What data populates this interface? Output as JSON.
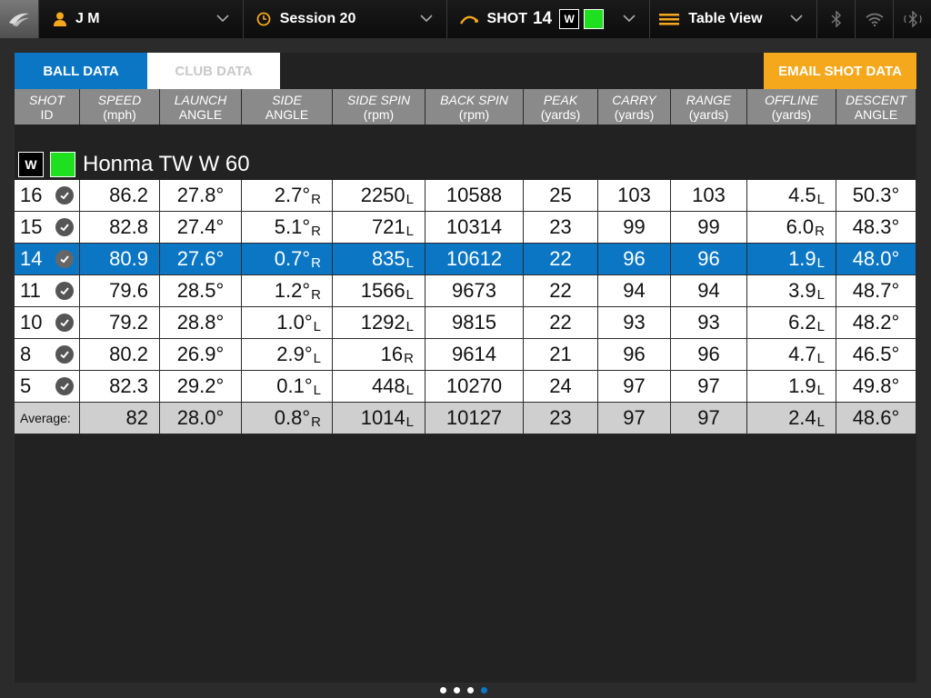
{
  "topbar": {
    "user": "J M",
    "session": "Session 20",
    "shot_label": "SHOT",
    "shot_number": "14",
    "club_badge": "W",
    "view": "Table View"
  },
  "tabs": {
    "ball": "BALL DATA",
    "club": "CLUB DATA",
    "email": "EMAIL SHOT DATA"
  },
  "headers": [
    {
      "t": "SHOT",
      "b": "ID"
    },
    {
      "t": "SPEED",
      "b": "(mph)"
    },
    {
      "t": "LAUNCH",
      "b": "ANGLE"
    },
    {
      "t": "SIDE",
      "b": "ANGLE"
    },
    {
      "t": "SIDE SPIN",
      "b": "(rpm)"
    },
    {
      "t": "BACK SPIN",
      "b": "(rpm)"
    },
    {
      "t": "PEAK",
      "b": "(yards)"
    },
    {
      "t": "CARRY",
      "b": "(yards)"
    },
    {
      "t": "RANGE",
      "b": "(yards)"
    },
    {
      "t": "OFFLINE",
      "b": "(yards)"
    },
    {
      "t": "DESCENT",
      "b": "ANGLE"
    }
  ],
  "club": {
    "badge": "W",
    "name": "Honma TW W 60"
  },
  "rows": [
    {
      "id": "16",
      "speed": "86.2",
      "launch": "27.8°",
      "side": "2.7°",
      "side_d": "R",
      "spin": "2250",
      "spin_d": "L",
      "back": "10588",
      "peak": "25",
      "carry": "103",
      "range": "103",
      "off": "4.5",
      "off_d": "L",
      "desc": "50.3°"
    },
    {
      "id": "15",
      "speed": "82.8",
      "launch": "27.4°",
      "side": "5.1°",
      "side_d": "R",
      "spin": "721",
      "spin_d": "L",
      "back": "10314",
      "peak": "23",
      "carry": "99",
      "range": "99",
      "off": "6.0",
      "off_d": "R",
      "desc": "48.3°"
    },
    {
      "id": "14",
      "speed": "80.9",
      "launch": "27.6°",
      "side": "0.7°",
      "side_d": "R",
      "spin": "835",
      "spin_d": "L",
      "back": "10612",
      "peak": "22",
      "carry": "96",
      "range": "96",
      "off": "1.9",
      "off_d": "L",
      "desc": "48.0°"
    },
    {
      "id": "11",
      "speed": "79.6",
      "launch": "28.5°",
      "side": "1.2°",
      "side_d": "R",
      "spin": "1566",
      "spin_d": "L",
      "back": "9673",
      "peak": "22",
      "carry": "94",
      "range": "94",
      "off": "3.9",
      "off_d": "L",
      "desc": "48.7°"
    },
    {
      "id": "10",
      "speed": "79.2",
      "launch": "28.8°",
      "side": "1.0°",
      "side_d": "L",
      "spin": "1292",
      "spin_d": "L",
      "back": "9815",
      "peak": "22",
      "carry": "93",
      "range": "93",
      "off": "6.2",
      "off_d": "L",
      "desc": "48.2°"
    },
    {
      "id": "8",
      "speed": "80.2",
      "launch": "26.9°",
      "side": "2.9°",
      "side_d": "L",
      "spin": "16",
      "spin_d": "R",
      "back": "9614",
      "peak": "21",
      "carry": "96",
      "range": "96",
      "off": "4.7",
      "off_d": "L",
      "desc": "46.5°"
    },
    {
      "id": "5",
      "speed": "82.3",
      "launch": "29.2°",
      "side": "0.1°",
      "side_d": "L",
      "spin": "448",
      "spin_d": "L",
      "back": "10270",
      "peak": "24",
      "carry": "97",
      "range": "97",
      "off": "1.9",
      "off_d": "L",
      "desc": "49.8°"
    }
  ],
  "selected_row": 2,
  "average": {
    "label": "Average:",
    "speed": "82",
    "launch": "28.0°",
    "side": "0.8°",
    "side_d": "R",
    "spin": "1014",
    "spin_d": "L",
    "back": "10127",
    "peak": "23",
    "carry": "97",
    "range": "97",
    "off": "2.4",
    "off_d": "L",
    "desc": "48.6°"
  },
  "pages": {
    "count": 4,
    "current": 3
  },
  "colors": {
    "accent": "#0a76c4",
    "email": "#f6a81c",
    "club_color": "#1ee01e",
    "header": "#8a8a8a"
  }
}
